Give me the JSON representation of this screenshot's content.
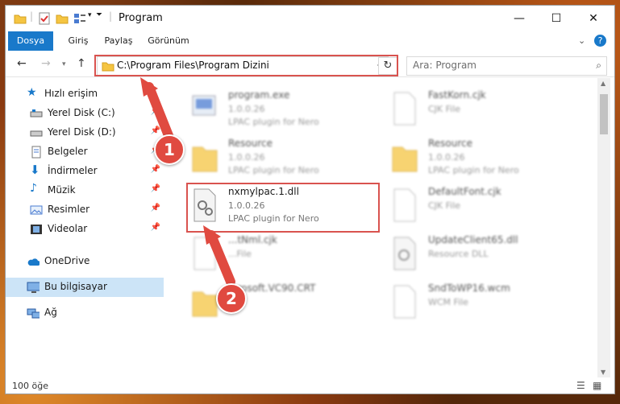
{
  "window": {
    "title": "Program"
  },
  "ribbon": {
    "tabs": [
      "Dosya",
      "Giriş",
      "Paylaş",
      "Görünüm"
    ]
  },
  "address": {
    "path": "C:\\Program Files\\Program Dizini"
  },
  "search": {
    "placeholder": "Ara: Program"
  },
  "sidebar": {
    "items": [
      {
        "label": "Hızlı erişim"
      },
      {
        "label": "Yerel Disk (C:)"
      },
      {
        "label": "Yerel Disk (D:)"
      },
      {
        "label": "Belgeler"
      },
      {
        "label": "İndirmeler"
      },
      {
        "label": "Müzik"
      },
      {
        "label": "Resimler"
      },
      {
        "label": "Videolar"
      },
      {
        "label": "OneDrive"
      },
      {
        "label": "Bu bilgisayar"
      },
      {
        "label": "Ağ"
      }
    ]
  },
  "files": [
    {
      "name": "program.exe",
      "line2": "1.0.0.26",
      "line3": "LPAC plugin for Nero"
    },
    {
      "name": "FastKorn.cjk",
      "line2": "CJK File",
      "line3": ""
    },
    {
      "name": "Resource",
      "line2": "1.0.0.26",
      "line3": "LPAC plugin for Nero"
    },
    {
      "name": "Resource",
      "line2": "1.0.0.26",
      "line3": "LPAC plugin for Nero"
    },
    {
      "name": "nxmylpac.1.dll",
      "line2": "1.0.0.26",
      "line3": "LPAC plugin for Nero"
    },
    {
      "name": "DefaultFont.cjk",
      "line2": "CJK File",
      "line3": ""
    },
    {
      "name": "...tNml.cjk",
      "line2": "...File",
      "line3": ""
    },
    {
      "name": "UpdateClient65.dll",
      "line2": "Resource DLL",
      "line3": ""
    },
    {
      "name": "...rosoft.VC90.CRT",
      "line2": "",
      "line3": ""
    },
    {
      "name": "SndToWP16.wcm",
      "line2": "WCM File",
      "line3": ""
    }
  ],
  "status": {
    "count": "100 öğe"
  },
  "callouts": [
    "1",
    "2"
  ],
  "colors": {
    "accent": "#1979ca",
    "highlight": "#d9534f",
    "selected": "#cce4f7"
  }
}
